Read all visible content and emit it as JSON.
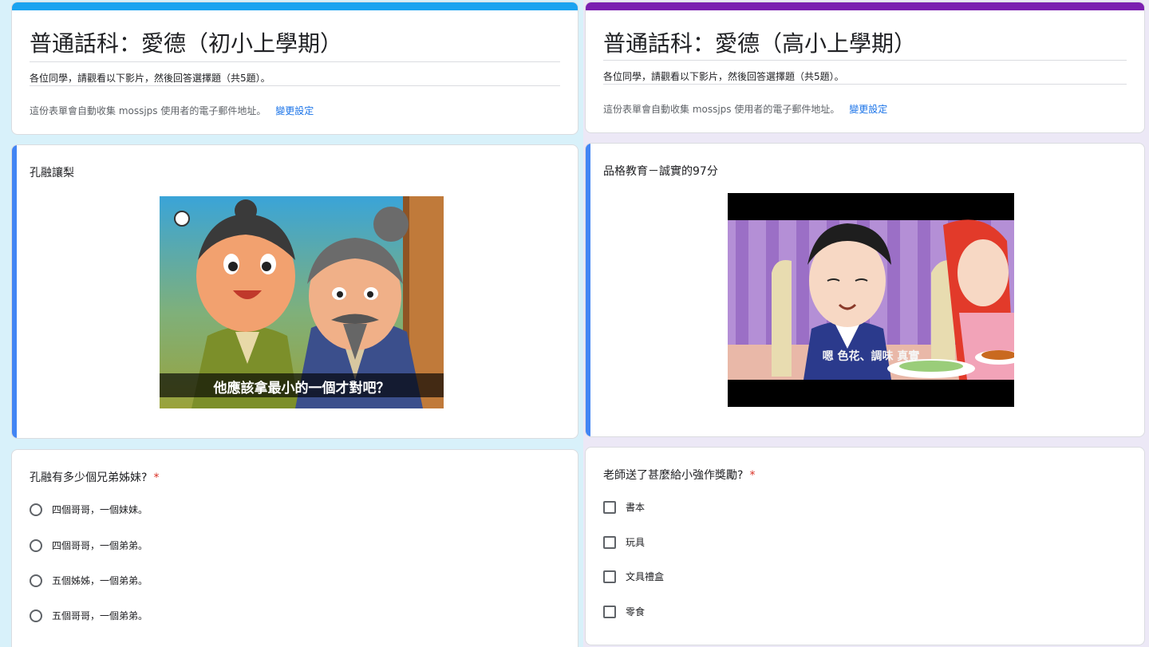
{
  "colors": {
    "left_accent": "#1aa3f0",
    "right_accent": "#7b1fb0",
    "left_background": "#d8f1fa",
    "right_background": "#ece8f6",
    "active_border": "#4285f4",
    "link": "#1a73e8",
    "required": "#d93025"
  },
  "left_form": {
    "title": "普通話科：愛德（初小上學期）",
    "description": "各位同學，請觀看以下影片，然後回答選擇題（共5題）。",
    "email_notice": "這份表單會自動收集 mossjps 使用者的電子郵件地址。",
    "change_settings": "變更設定",
    "section_title": "孔融讓梨",
    "video_subtitle": "他應該拿最小的一個才對吧？",
    "question": {
      "text": "孔融有多少個兄弟姊妹?",
      "required_mark": "*",
      "options": [
        "四個哥哥，一個妹妹。",
        "四個哥哥，一個弟弟。",
        "五個姊姊，一個弟弟。",
        "五個哥哥，一個弟弟。"
      ]
    }
  },
  "right_form": {
    "title": "普通話科：愛德（高小上學期）",
    "description": "各位同學，請觀看以下影片，然後回答選擇題（共5題）。",
    "email_notice": "這份表單會自動收集 mossjps 使用者的電子郵件地址。",
    "change_settings": "變更設定",
    "section_title": "品格教育－誠實的97分",
    "video_subtitle": "嗯 色花、調味 真實",
    "question": {
      "text": "老師送了甚麼給小強作獎勵?",
      "required_mark": "*",
      "options": [
        "書本",
        "玩具",
        "文具禮盒",
        "零食"
      ]
    }
  }
}
